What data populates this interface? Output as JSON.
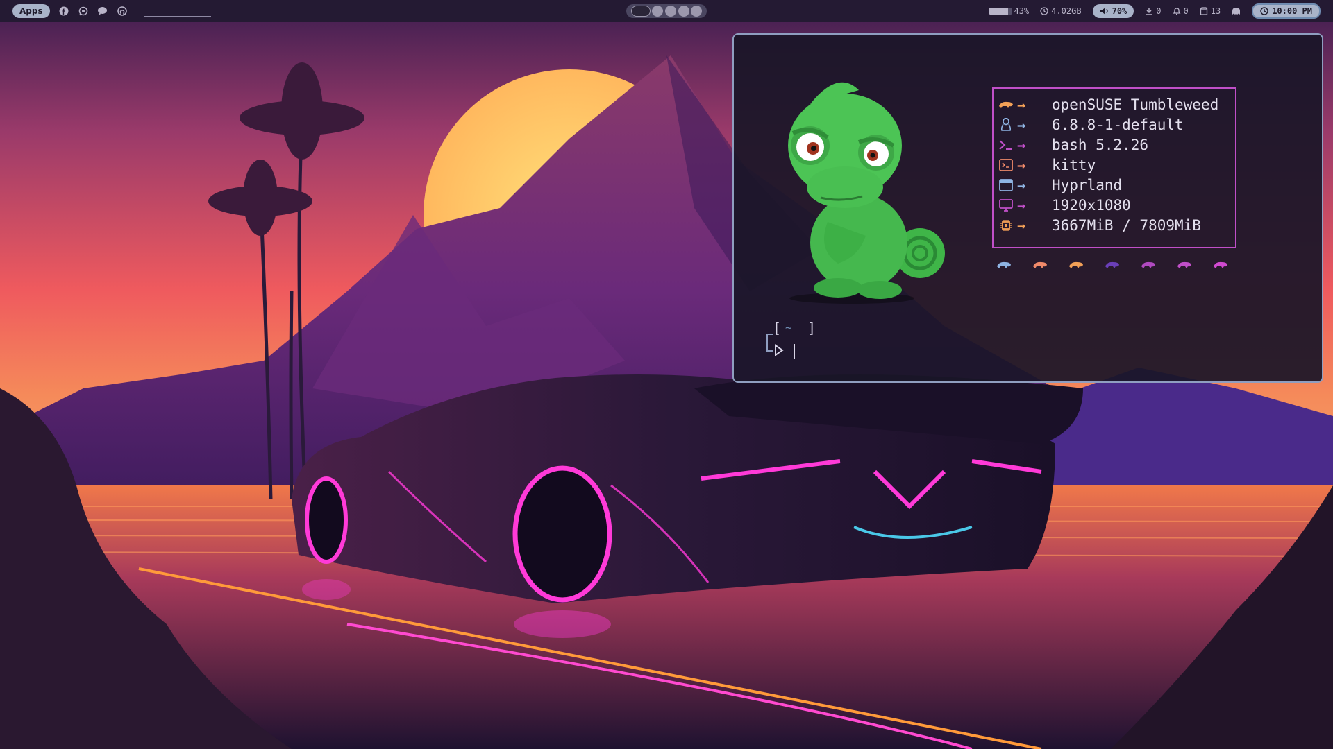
{
  "topbar": {
    "apps_label": "Apps",
    "left_icons": [
      "facebook-icon",
      "whatsapp-icon",
      "chat-icon",
      "github-icon"
    ],
    "workspaces": {
      "count": 5,
      "active_index": 0
    },
    "memory_percent": "43%",
    "disk_usage": "4.02GB",
    "volume": "70%",
    "downloads_count": "0",
    "notifications_count": "0",
    "updates_count": "13",
    "clock": "10:00 PM"
  },
  "terminal": {
    "info": [
      {
        "icon": "opensuse-chameleon-icon",
        "text": "openSUSE Tumbleweed",
        "color": "#f2a057"
      },
      {
        "icon": "linux-tux-icon",
        "text": "6.8.8-1-default",
        "color": "#8fb4e3"
      },
      {
        "icon": "shell-prompt-icon",
        "text": "bash 5.2.26",
        "color": "#c04fc8"
      },
      {
        "icon": "terminal-icon",
        "text": "kitty",
        "color": "#f08a6a"
      },
      {
        "icon": "window-icon",
        "text": "Hyprland",
        "color": "#8fb4e3"
      },
      {
        "icon": "monitor-icon",
        "text": "1920x1080",
        "color": "#c04fc8"
      },
      {
        "icon": "chip-icon",
        "text": "3667MiB / 7809MiB",
        "color": "#f2a057"
      }
    ],
    "frame_color": "#c04fc8",
    "color_blocks": [
      "#8fb4e3",
      "#f08a6a",
      "#f2a057",
      "#6a3fb8",
      "#b04ac0",
      "#c04fc8",
      "#d04ad0"
    ],
    "prompt": {
      "dir": "~"
    }
  }
}
